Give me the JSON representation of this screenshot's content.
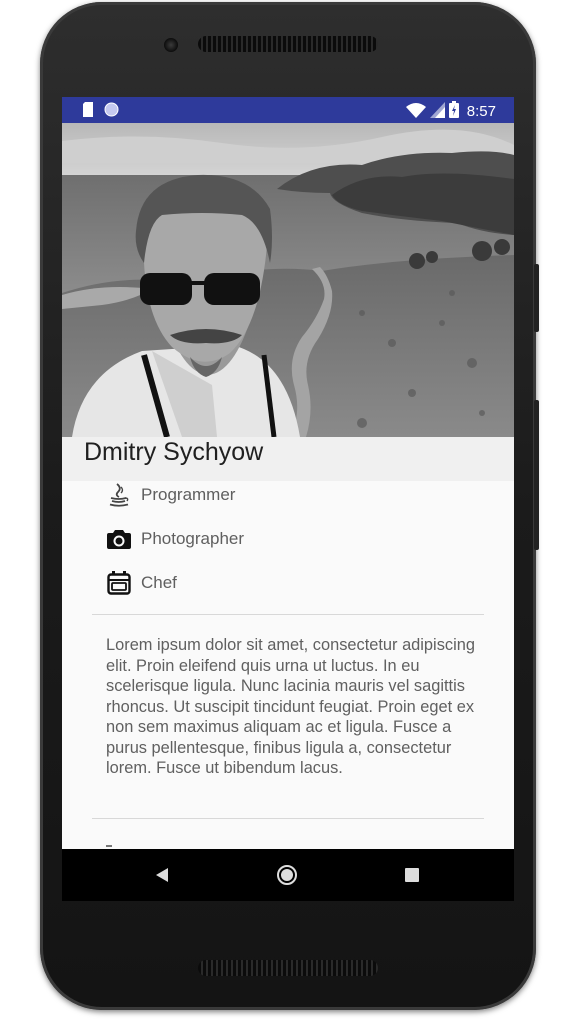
{
  "status_bar": {
    "time": "8:57",
    "left_icons": [
      "sd-card-icon",
      "circle-notification-icon"
    ],
    "right_icons": [
      "wifi-icon",
      "cell-signal-icon",
      "battery-charging-icon"
    ]
  },
  "profile": {
    "name": "Dmitry Sychyow",
    "roles": [
      {
        "label": "Programmer",
        "icon": "java-icon"
      },
      {
        "label": "Photographer",
        "icon": "camera-icon"
      },
      {
        "label": "Chef",
        "icon": "oven-icon"
      }
    ],
    "bio": "Lorem ipsum dolor sit amet, consectetur adipiscing elit. Proin eleifend quis urna ut luctus. In eu scelerisque ligula. Nunc lacinia mauris vel sagittis rhoncus. Ut suscipit tincidunt feugiat. Proin eget ex non sem maximus aliquam ac et ligula. Fusce a purus pellentesque, finibus ligula a, consectetur lorem. Fusce ut bibendum lacus."
  },
  "nav_bar": {
    "buttons": [
      "back-icon",
      "home-icon",
      "recents-icon"
    ]
  },
  "colors": {
    "status_bar": "#2e3a9b",
    "background": "#fafafa",
    "name_bar": "#f0f0f0",
    "nav_bar": "#000000"
  }
}
